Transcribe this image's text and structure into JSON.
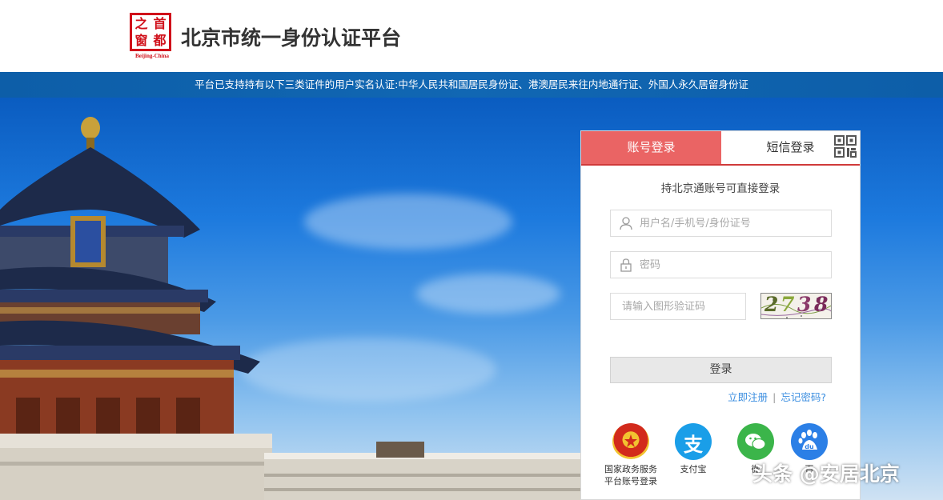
{
  "header": {
    "logo_chars": [
      "之",
      "首",
      "窗",
      "都"
    ],
    "logo_caption": "Beijing-China",
    "title": "北京市统一身份认证平台"
  },
  "notice": {
    "text": "平台已支持持有以下三类证件的用户实名认证:中华人民共和国居民身份证、港澳居民来往内地通行证、外国人永久居留身份证"
  },
  "login": {
    "tabs": [
      {
        "label": "账号登录",
        "active": true
      },
      {
        "label": "短信登录",
        "active": false
      }
    ],
    "tip": "持北京通账号可直接登录",
    "username_placeholder": "用户名/手机号/身份证号",
    "password_placeholder": "密码",
    "captcha_placeholder": "请输入图形验证码",
    "captcha_chars": [
      "2",
      "7",
      "3",
      "8"
    ],
    "submit_label": "登录",
    "register_link": "立即注册",
    "forgot_link": "忘记密码?",
    "link_separator": "|",
    "third_party": [
      {
        "label_line1": "国家政务服务",
        "label_line2": "平台账号登录",
        "icon": "national-emblem-icon"
      },
      {
        "label_line1": "支付宝",
        "label_line2": "",
        "icon": "alipay-icon",
        "glyph": "支"
      },
      {
        "label_line1": "微",
        "label_line2": "",
        "icon": "wechat-icon"
      },
      {
        "label_line1": "百",
        "label_line2": "",
        "icon": "baidu-icon",
        "glyph": "du"
      }
    ]
  },
  "watermark": "头条 @安居北京",
  "colors": {
    "accent_red": "#ea6464",
    "notice_blue": "#1167b3",
    "link_blue": "#3b8ee0",
    "alipay_blue": "#1a9ee8",
    "wechat_green": "#3bb54a",
    "baidu_blue": "#2b7fe6"
  }
}
